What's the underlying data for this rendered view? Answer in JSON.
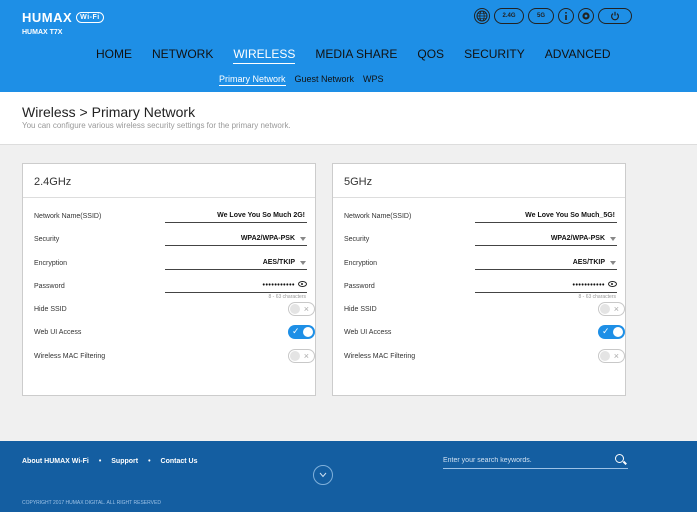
{
  "header": {
    "logo": "HUMAX",
    "logo_badge": "Wi-Fi",
    "model": "HUMAX T7X",
    "icons": [
      "globe-icon",
      "band-2g-icon",
      "band-5g-icon",
      "info-icon",
      "settings-icon",
      "power-icon"
    ],
    "band_a": "2.4G",
    "band_b": "5G"
  },
  "nav": {
    "main": [
      "HOME",
      "NETWORK",
      "WIRELESS",
      "MEDIA SHARE",
      "QOS",
      "SECURITY",
      "ADVANCED"
    ],
    "active": "WIRELESS",
    "sub": [
      "Primary Network",
      "Guest Network",
      "WPS"
    ],
    "sub_active": "Primary Network"
  },
  "page": {
    "title": "Wireless > Primary Network",
    "description": "You can configure various wireless security settings for the primary network."
  },
  "labels": {
    "ssid": "Network Name(SSID)",
    "security": "Security",
    "encryption": "Encryption",
    "password": "Password",
    "hide_ssid": "Hide SSID",
    "web_ui": "Web UI Access",
    "mac_filter": "Wireless MAC Filtering",
    "pw_hint": "8 - 63 characters"
  },
  "panels": [
    {
      "band": "2.4GHz",
      "ssid": "We Love You So Much 2G!",
      "security": "WPA2/WPA-PSK",
      "encryption": "AES/TKIP",
      "password_mask": "•••••••••••",
      "hide_ssid": false,
      "web_ui_access": true,
      "mac_filtering": false
    },
    {
      "band": "5GHz",
      "ssid": "We Love You So Much_5G!",
      "security": "WPA2/WPA-PSK",
      "encryption": "AES/TKIP",
      "password_mask": "•••••••••••",
      "hide_ssid": false,
      "web_ui_access": true,
      "mac_filtering": false
    }
  ],
  "footer": {
    "links": [
      "About HUMAX Wi-Fi",
      "Support",
      "Contact Us"
    ],
    "separator": "•",
    "search_placeholder": "Enter your search keywords.",
    "copyright": "COPYRIGHT 2017 HUMAX DIGITAL. ALL RIGHT RESERVED"
  }
}
